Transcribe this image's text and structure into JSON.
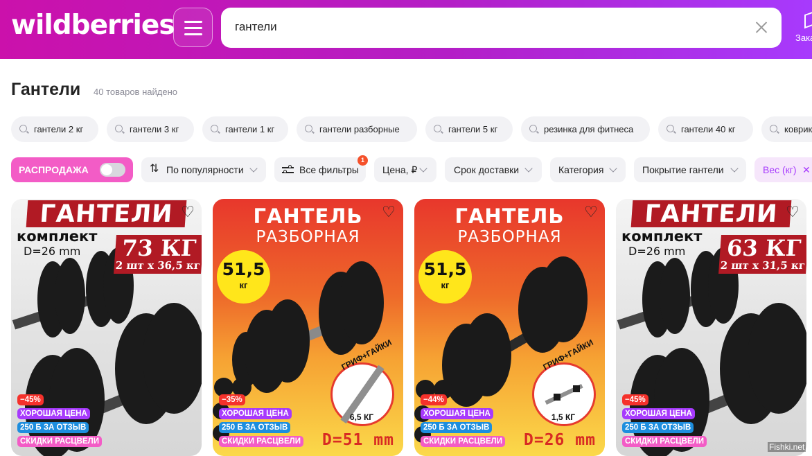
{
  "header": {
    "logo": "wildberries",
    "search_value": "гантели",
    "orders_label": "Зака"
  },
  "page": {
    "title": "Гантели",
    "found": "40 товаров найдено"
  },
  "suggestions": [
    "гантели 2 кг",
    "гантели 3 кг",
    "гантели 1 кг",
    "гантели разборные",
    "гантели 5 кг",
    "резинка для фитнеса",
    "гантели 40 кг",
    "коврик"
  ],
  "filters": {
    "sale": "РАСПРОДАЖА",
    "sale_enabled": false,
    "sort": "По популярности",
    "all_filters": "Все фильтры",
    "all_filters_badge": "1",
    "price": "Цена, ₽",
    "delivery": "Срок доставки",
    "category": "Категория",
    "coating": "Покрытие гантели",
    "weight": "Вес (кг)",
    "weight_remove": "✕"
  },
  "products": [
    {
      "style": "bw",
      "banner": "ГАНТЕЛИ",
      "subtitle": "комплект",
      "diameter": "D=26 mm",
      "weight": "73 КГ",
      "pair": "2 шт х 36,5 кг",
      "discount": "−45%",
      "good_price": "ХОРОШАЯ ЦЕНА",
      "review_bonus": "250 Б ЗА ОТЗЫВ",
      "spring_sale": "СКИДКИ РАСЦВЕЛИ"
    },
    {
      "style": "warm",
      "banner": "ГАНТЕЛЬ",
      "subtitle": "РАЗБОРНАЯ",
      "circle_weight": "51,5",
      "circle_unit": "кг",
      "grif_label": "ГРИФ+ГАЙКИ",
      "grif_weight": "6,5 КГ",
      "diameter": "D=51 mm",
      "discount": "−35%",
      "good_price": "ХОРОШАЯ ЦЕНА",
      "review_bonus": "250 Б ЗА ОТЗЫВ",
      "spring_sale": "СКИДКИ РАСЦВЕЛИ"
    },
    {
      "style": "warm",
      "banner": "ГАНТЕЛЬ",
      "subtitle": "РАЗБОРНАЯ",
      "circle_weight": "51,5",
      "circle_unit": "кг",
      "grif_label": "ГРИФ+ГАЙКИ",
      "grif_weight": "1,5 КГ",
      "diameter": "D=26 mm",
      "discount": "−44%",
      "good_price": "ХОРОШАЯ ЦЕНА",
      "review_bonus": "250 Б ЗА ОТЗЫВ",
      "spring_sale": "СКИДКИ РАСЦВЕЛИ"
    },
    {
      "style": "bw",
      "banner": "ГАНТЕЛИ",
      "subtitle": "комплект",
      "diameter": "D=26 mm",
      "weight": "63 КГ",
      "pair": "2 шт х 31,5 кг",
      "discount": "−45%",
      "good_price": "ХОРОШАЯ ЦЕНА",
      "review_bonus": "250 Б ЗА ОТЗЫВ",
      "spring_sale": "СКИДКИ РАСЦВЕЛИ"
    }
  ],
  "watermark": "Fishki.net",
  "colors": {
    "brand_gradient_start": "#cb11ab",
    "brand_gradient_end": "#a73afd",
    "sale_pink": "#f35cc6",
    "discount_red": "#f5312b",
    "good_price_purple": "#a73afd",
    "review_blue": "#1d8ede"
  }
}
